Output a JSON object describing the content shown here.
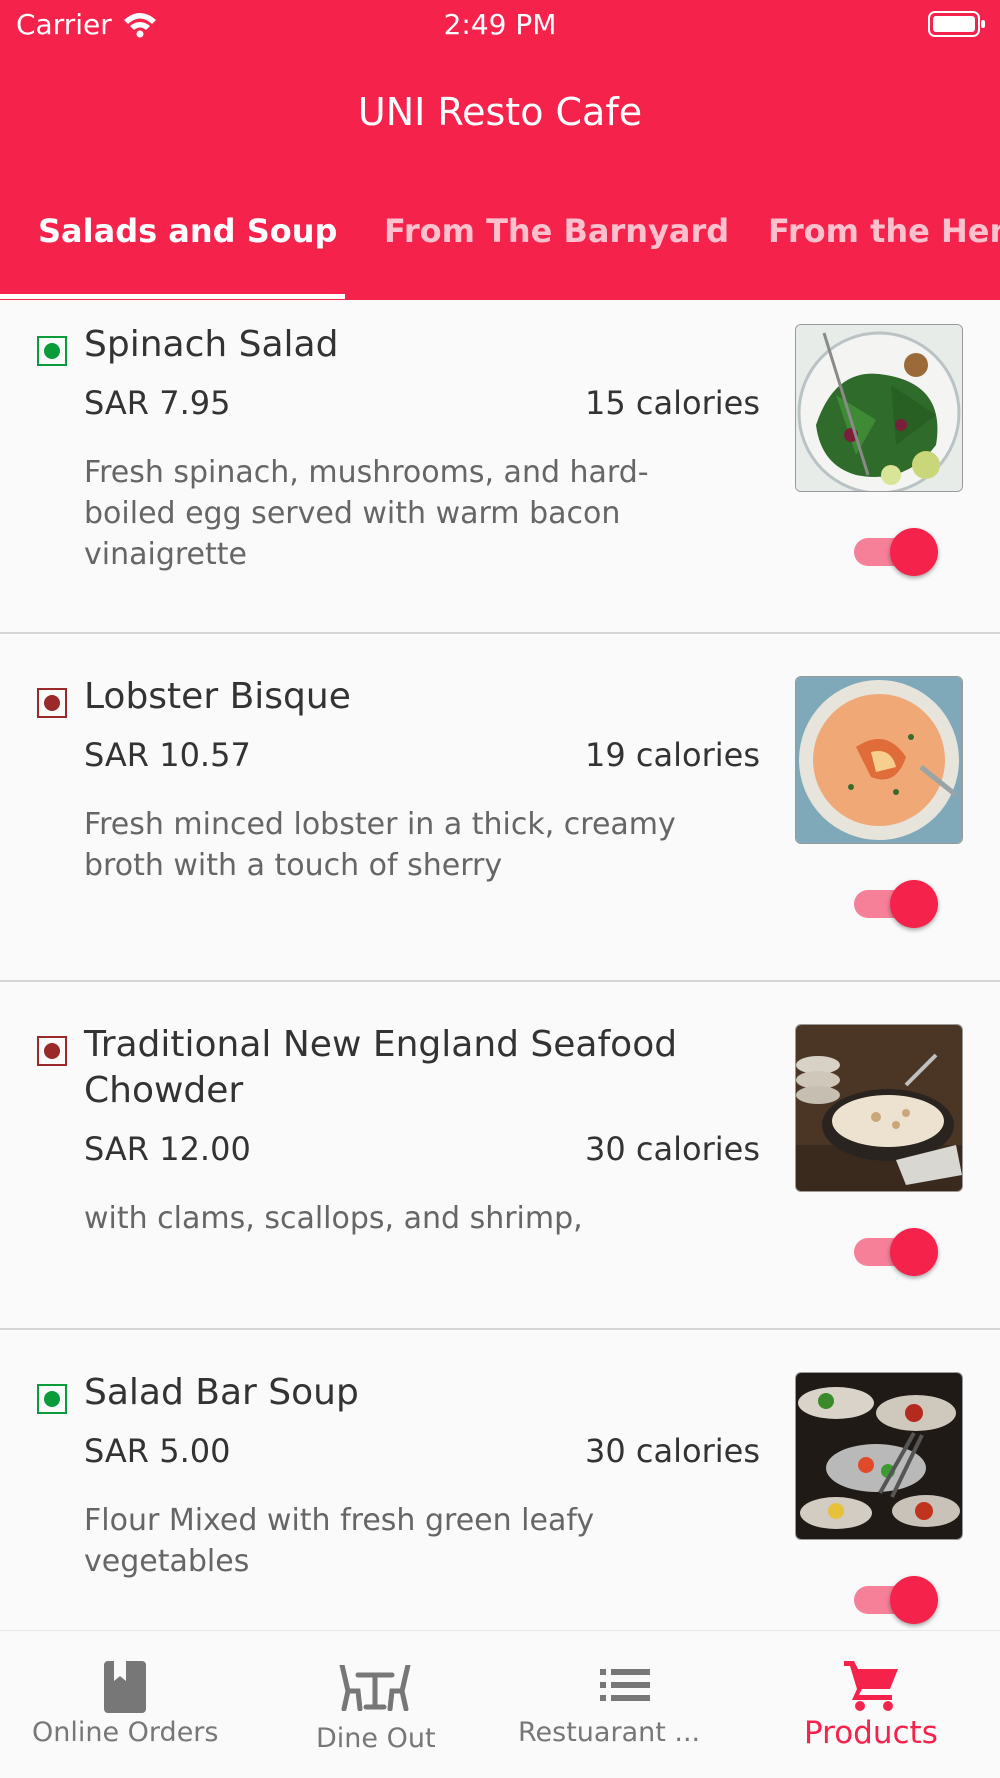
{
  "status_bar": {
    "carrier": "Carrier",
    "time": "2:49 PM"
  },
  "app_bar": {
    "title": "UNI Resto Cafe"
  },
  "tabs": [
    {
      "label": "Salads and Soup",
      "active": true
    },
    {
      "label": "From The Barnyard",
      "active": false
    },
    {
      "label": "From the Hen H",
      "active": false
    }
  ],
  "items": [
    {
      "name": "Spinach Salad",
      "price": "SAR 7.95",
      "calories": "15 calories",
      "description": "Fresh spinach, mushrooms, and hard-boiled egg served with warm bacon vinaigrette",
      "type": "veg",
      "available": true,
      "image": "spinach salad photo"
    },
    {
      "name": "Lobster Bisque",
      "price": "SAR 10.57",
      "calories": "19 calories",
      "description": "Fresh minced lobster in a thick, creamy broth with a touch of sherry",
      "type": "non-veg",
      "available": true,
      "image": "lobster bisque photo"
    },
    {
      "name": "Traditional New England Seafood Chowder",
      "price": "SAR 12.00",
      "calories": "30 calories",
      "description": "with clams, scallops, and shrimp,",
      "type": "non-veg",
      "available": true,
      "image": "seafood chowder photo"
    },
    {
      "name": "Salad Bar Soup",
      "price": "SAR 5.00",
      "calories": "30 calories",
      "description": "Flour Mixed with fresh green leafy vegetables",
      "type": "veg",
      "available": true,
      "image": "salad bar photo"
    }
  ],
  "bottom_nav": [
    {
      "label": "Online Orders",
      "icon": "book-icon",
      "active": false
    },
    {
      "label": "Dine Out",
      "icon": "table-chairs-icon",
      "active": false
    },
    {
      "label": "Restuarant ...",
      "icon": "list-icon",
      "active": false
    },
    {
      "label": "Products",
      "icon": "cart-icon",
      "active": true
    }
  ],
  "colors": {
    "accent": "#f5234c",
    "veg": "#0a9b3a",
    "non_veg": "#9a2a2a",
    "toggle_track": "#f58098"
  }
}
